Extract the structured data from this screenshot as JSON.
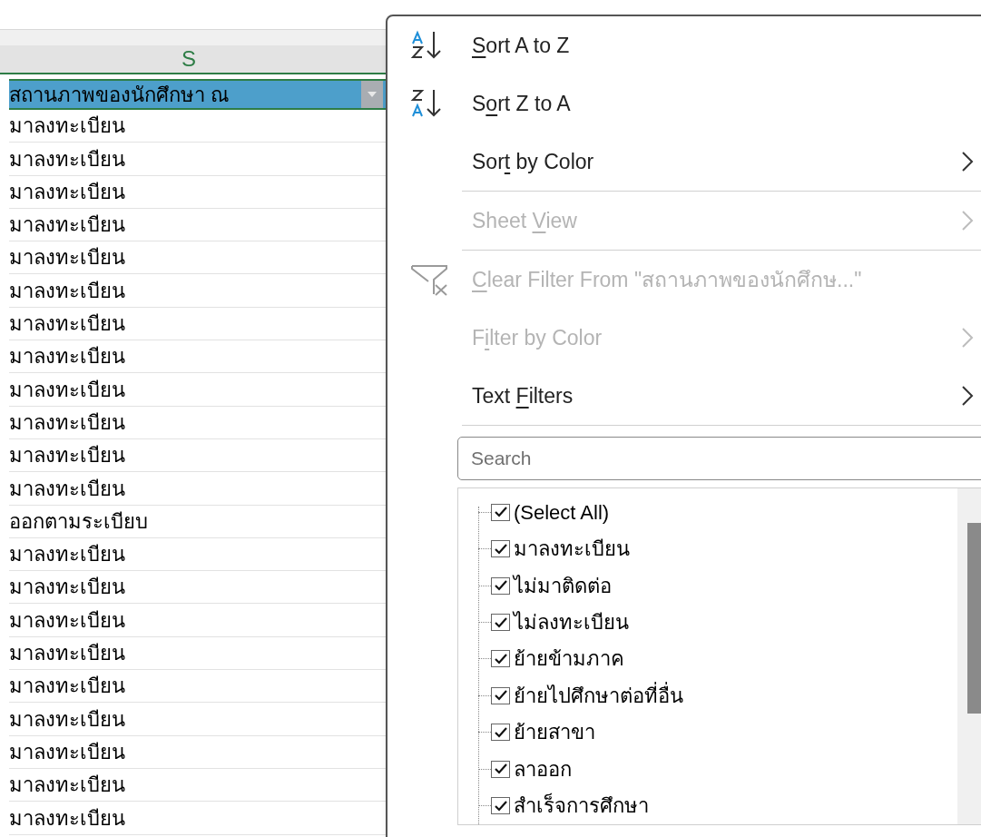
{
  "sheet": {
    "column_letter": "S",
    "header": "สถานภาพของนักศึกษา ณ",
    "cells": [
      "มาลงทะเบียน",
      "มาลงทะเบียน",
      "มาลงทะเบียน",
      "มาลงทะเบียน",
      "มาลงทะเบียน",
      "มาลงทะเบียน",
      "มาลงทะเบียน",
      "มาลงทะเบียน",
      "มาลงทะเบียน",
      "มาลงทะเบียน",
      "มาลงทะเบียน",
      "มาลงทะเบียน",
      "ออกตามระเบียบ",
      "มาลงทะเบียน",
      "มาลงทะเบียน",
      "มาลงทะเบียน",
      "มาลงทะเบียน",
      "มาลงทะเบียน",
      "มาลงทะเบียน",
      "มาลงทะเบียน",
      "มาลงทะเบียน",
      "มาลงทะเบียน"
    ]
  },
  "menu": {
    "items": [
      {
        "kind": "sort_asc",
        "label_parts": {
          "key": "S",
          "after": "ort A to Z"
        },
        "disabled": false,
        "submenu": false
      },
      {
        "kind": "sort_desc",
        "label_parts": {
          "before": "S",
          "key": "o",
          "after": "rt Z to A"
        },
        "disabled": false,
        "submenu": false
      },
      {
        "kind": "plain",
        "label_parts": {
          "before": "Sor",
          "key": "t",
          "after": " by Color"
        },
        "disabled": false,
        "submenu": true,
        "separator_after": true
      },
      {
        "kind": "plain",
        "label_parts": {
          "before": "Sheet ",
          "key": "V",
          "after": "iew"
        },
        "disabled": true,
        "submenu": true,
        "separator_after": true
      },
      {
        "kind": "clear_filter",
        "label_parts": {
          "key": "C",
          "after": "lear Filter From \"สถานภาพของนักศึกษ...\""
        },
        "disabled": true,
        "submenu": false
      },
      {
        "kind": "plain",
        "label_parts": {
          "before": "F",
          "key": "i",
          "after": "lter by Color"
        },
        "disabled": true,
        "submenu": true
      },
      {
        "kind": "plain",
        "label_parts": {
          "before": "Text ",
          "key": "F",
          "after": "ilters"
        },
        "disabled": false,
        "submenu": true,
        "separator_after": true
      }
    ],
    "search": {
      "placeholder": "Search"
    },
    "values": [
      {
        "label": "(Select All)",
        "checked": true
      },
      {
        "label": "มาลงทะเบียน",
        "checked": true
      },
      {
        "label": "ไม่มาติดต่อ",
        "checked": true
      },
      {
        "label": "ไม่ลงทะเบียน",
        "checked": true
      },
      {
        "label": "ย้ายข้ามภาค",
        "checked": true
      },
      {
        "label": "ย้ายไปศึกษาต่อที่อื่น",
        "checked": true
      },
      {
        "label": "ย้ายสาขา",
        "checked": true
      },
      {
        "label": "ลาออก",
        "checked": true
      },
      {
        "label": "สำเร็จการศึกษา",
        "checked": true
      }
    ]
  }
}
